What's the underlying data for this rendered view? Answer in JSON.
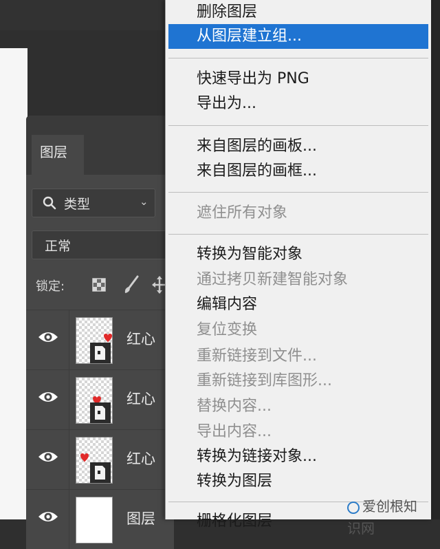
{
  "layers_panel": {
    "tab_label": "图层",
    "filter_label": "类型",
    "blend_mode": "正常",
    "lock_label": "锁定:",
    "layers": [
      {
        "name": "红心"
      },
      {
        "name": "红心"
      },
      {
        "name": "红心"
      },
      {
        "name": "图层"
      }
    ]
  },
  "context_menu": {
    "items": [
      {
        "label": "删除图层",
        "enabled": true
      },
      {
        "label": "从图层建立组...",
        "enabled": true,
        "selected": true
      },
      {
        "label": "快速导出为 PNG",
        "enabled": true
      },
      {
        "label": "导出为...",
        "enabled": true
      },
      {
        "label": "来自图层的画板...",
        "enabled": true
      },
      {
        "label": "来自图层的画框...",
        "enabled": true
      },
      {
        "label": "遮住所有对象",
        "enabled": false
      },
      {
        "label": "转换为智能对象",
        "enabled": true
      },
      {
        "label": "通过拷贝新建智能对象",
        "enabled": false
      },
      {
        "label": "编辑内容",
        "enabled": true
      },
      {
        "label": "复位变换",
        "enabled": false
      },
      {
        "label": "重新链接到文件...",
        "enabled": false
      },
      {
        "label": "重新链接到库图形...",
        "enabled": false
      },
      {
        "label": "替换内容...",
        "enabled": false
      },
      {
        "label": "导出内容...",
        "enabled": false
      },
      {
        "label": "转换为链接对象...",
        "enabled": true
      },
      {
        "label": "转换为图层",
        "enabled": true
      },
      {
        "label": "栅格化图层",
        "enabled": true
      }
    ]
  },
  "watermark": {
    "text": "爱创根知识网"
  },
  "colors": {
    "menu_highlight": "#1f74d2",
    "panel_bg": "#474747",
    "menu_bg": "#f0f0f0"
  }
}
